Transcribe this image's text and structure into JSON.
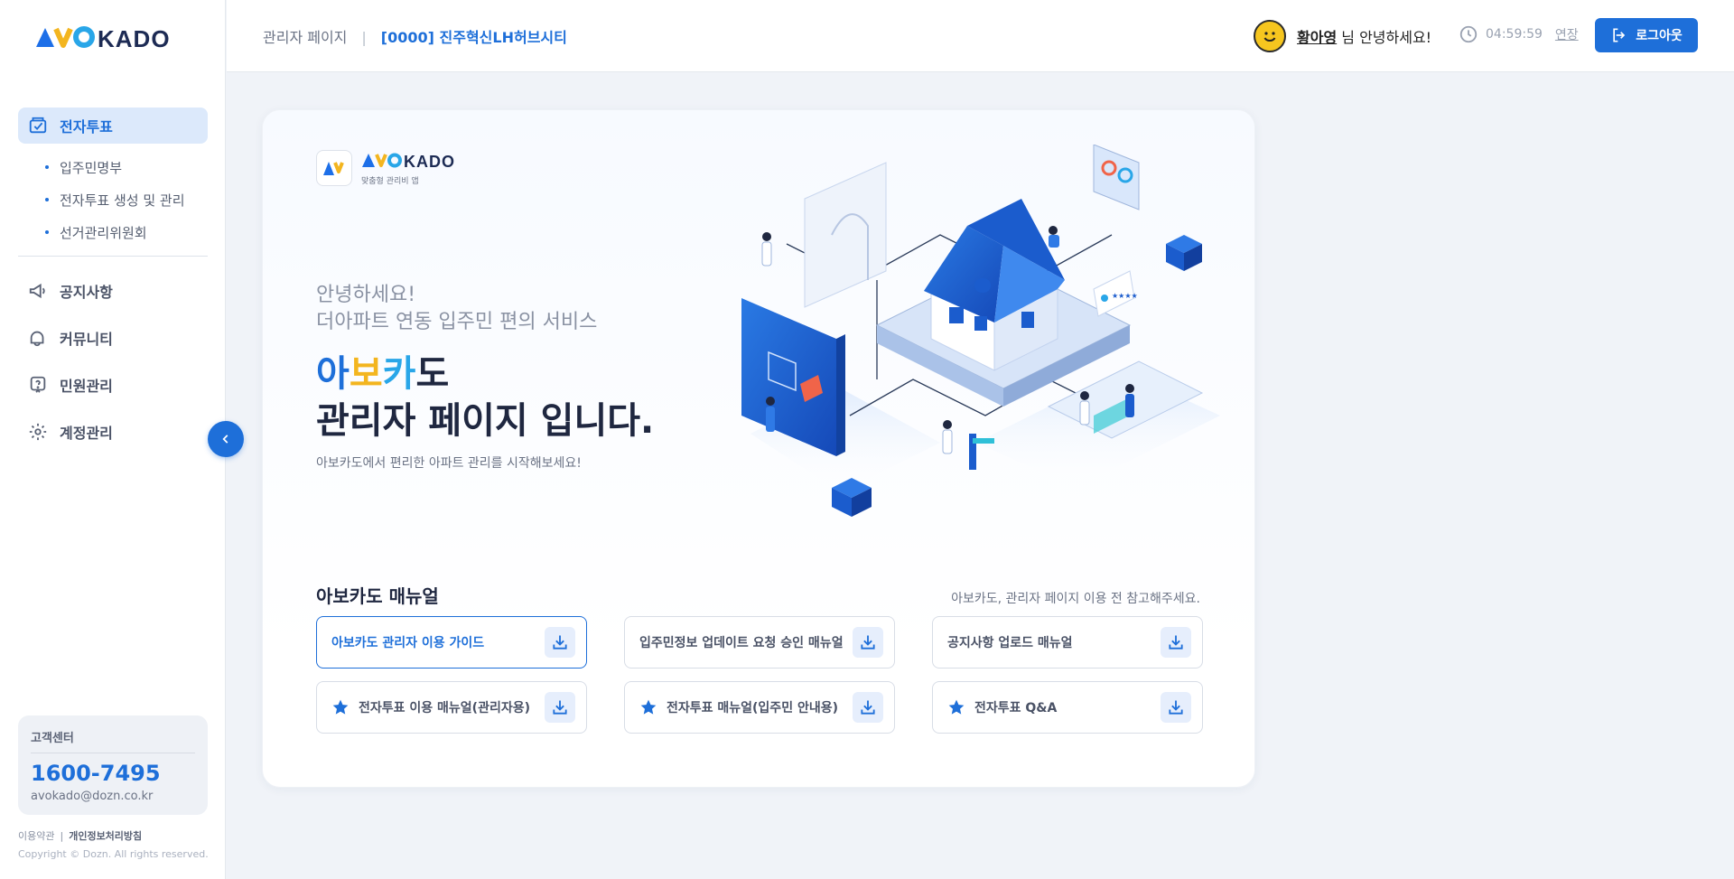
{
  "brand": {
    "logo_text": "AVOKADO",
    "tagline": "맞춤형 관리비 앱"
  },
  "sidebar": {
    "items": [
      {
        "label": "전자투표",
        "icon": "vote-check-icon",
        "active": true
      },
      {
        "label": "공지사항",
        "icon": "megaphone-icon"
      },
      {
        "label": "커뮤니티",
        "icon": "chat-bubbles-icon"
      },
      {
        "label": "민원관리",
        "icon": "question-bubble-icon"
      },
      {
        "label": "계정관리",
        "icon": "gear-icon"
      }
    ],
    "sub_items": [
      "입주민명부",
      "전자투표 생성 및 관리",
      "선거관리위원회"
    ],
    "customer_center": {
      "title": "고객센터",
      "phone": "1600-7495",
      "email": "avokado@dozn.co.kr"
    },
    "footer": {
      "terms": "이용약관",
      "separator": "|",
      "privacy": "개인정보처리방침",
      "copyright": "Copyright © Dozn. All rights reserved."
    }
  },
  "header": {
    "breadcrumb": {
      "page": "관리자 페이지",
      "separator": "|",
      "site": "[0000] 진주혁신LH허브시티"
    },
    "user": {
      "name": "황아영",
      "suffix": "님 안녕하세요!"
    },
    "timer": {
      "remaining": "04:59:59",
      "extend_label": "연장"
    },
    "logout_label": "로그아웃"
  },
  "main": {
    "greeting_line1": "안녕하세요!",
    "greeting_line2": "더아파트 연동 입주민 편의 서비스",
    "headline_c1": "아",
    "headline_c2": "보",
    "headline_c3": "카",
    "headline_c4": "도",
    "headline_line2": "관리자 페이지 입니다.",
    "description": "아보카도에서 편리한 아파트 관리를 시작해보세요!",
    "manual": {
      "title": "아보카도 매뉴얼",
      "note": "아보카도, 관리자 페이지 이용 전 참고해주세요.",
      "buttons": [
        {
          "label": "아보카도 관리자 이용 가이드",
          "starred": false,
          "primary": true
        },
        {
          "label": "입주민정보 업데이트 요청 승인 매뉴얼",
          "starred": false
        },
        {
          "label": "공지사항 업로드 매뉴얼",
          "starred": false
        },
        {
          "label": "전자투표 이용 매뉴얼(관리자용)",
          "starred": true
        },
        {
          "label": "전자투표 매뉴얼(입주민 안내용)",
          "starred": true
        },
        {
          "label": "전자투표 Q&A",
          "starred": true
        }
      ]
    }
  },
  "colors": {
    "primary": "#1e6fd9",
    "accent_yellow": "#f3b51f",
    "accent_sky": "#29a6e8",
    "navy": "#1d2b54"
  }
}
